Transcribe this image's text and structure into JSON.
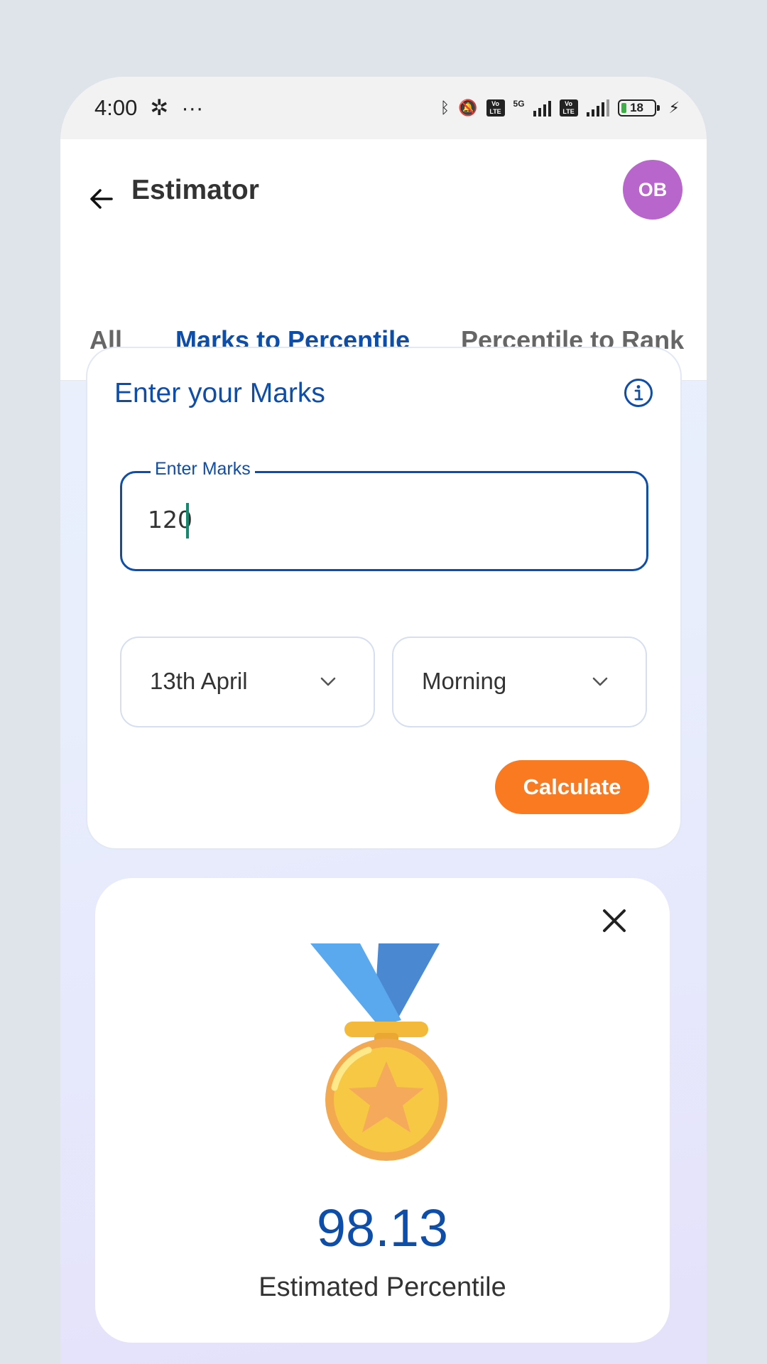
{
  "status_bar": {
    "time": "4:00",
    "more": "···",
    "battery_level": "18",
    "network": "5G",
    "icons": [
      "settings-icon",
      "bluetooth-icon",
      "mute-icon",
      "volte-icon",
      "signal-icon",
      "battery-icon",
      "charging-icon"
    ]
  },
  "header": {
    "title": "Estimator",
    "avatar_initials": "OB",
    "avatar_color": "#b866cc"
  },
  "tabs": [
    {
      "label": "All",
      "active": false
    },
    {
      "label": "Marks to Percentile",
      "active": true
    },
    {
      "label": "Percentile to Rank",
      "active": false
    }
  ],
  "input_card": {
    "title": "Enter your Marks",
    "field_label": "Enter Marks",
    "field_value": "120",
    "date_select": "13th April",
    "shift_select": "Morning",
    "calculate_label": "Calculate"
  },
  "result_card": {
    "value": "98.13",
    "label": "Estimated Percentile"
  },
  "colors": {
    "primary": "#0f4ea8",
    "accent": "#fa7a22"
  }
}
